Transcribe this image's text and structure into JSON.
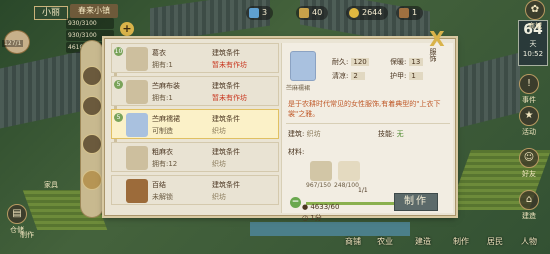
{
  "hud": {
    "player_name": "小丽",
    "region": "春来小镇",
    "stats": [
      "930/3100",
      "930/3100",
      "4610/3100"
    ],
    "population": "127/1"
  },
  "resources": [
    {
      "icon": "gem-icon",
      "value": "3",
      "color": "#5fa0d0"
    },
    {
      "icon": "food-icon",
      "value": "40",
      "color": "#c9a24a"
    },
    {
      "icon": "coin-icon",
      "value": "2644",
      "color": "#e0b840"
    },
    {
      "icon": "wood-icon",
      "value": "1",
      "color": "#a07040"
    }
  ],
  "season": {
    "number": "64",
    "unit": "天",
    "time": "10:52"
  },
  "right_buttons": [
    "商城",
    "事件",
    "活动",
    "好友",
    "建造"
  ],
  "left_buttons": [
    "家具",
    "仓储",
    "制作"
  ],
  "bottom_menu": [
    "商铺",
    "农业",
    "建造",
    "制作",
    "居民",
    "人物"
  ],
  "close_label": "X",
  "panel_side_label": "服饰",
  "items": [
    {
      "no": "10",
      "name": "葛衣",
      "owned": "拥有:1",
      "cond": "建筑条件",
      "cond_value": "暂未有作坊",
      "cond_color": "red"
    },
    {
      "no": "5",
      "name": "苎麻布装",
      "owned": "拥有:1",
      "cond": "建筑条件",
      "cond_value": "暂未有作坊",
      "cond_color": "red"
    },
    {
      "no": "5",
      "name": "苎麻襦裙",
      "owned": "可制造",
      "cond": "建筑条件",
      "cond_value": "织坊",
      "cond_color": "gray"
    },
    {
      "no": "",
      "name": "粗麻衣",
      "owned": "拥有:12",
      "cond": "建筑条件",
      "cond_value": "织坊",
      "cond_color": "gray"
    },
    {
      "no": "",
      "name": "百结",
      "owned": "未解锁",
      "cond": "建筑条件",
      "cond_value": "织坊",
      "cond_color": "gray"
    }
  ],
  "detail": {
    "name": "苎麻襦裙",
    "stats": [
      {
        "label": "耐久:",
        "value": "120"
      },
      {
        "label": "保暖:",
        "value": "13"
      },
      {
        "label": "清凉:",
        "value": "2"
      },
      {
        "label": "护甲:",
        "value": "1"
      }
    ],
    "description": "是于农耕时代常见的女性服饰,有着典型的\"上衣下裳\"之雅。",
    "building_label": "建筑:",
    "building_value": "织坊",
    "skill_label": "技能:",
    "skill_value": "无",
    "materials_label": "材料:",
    "materials": [
      {
        "name": "苎麻布",
        "qty": "967/150"
      },
      {
        "name": "丝线",
        "qty": "248/100"
      }
    ],
    "count": "1/1",
    "money": "4633/60",
    "time": "1分",
    "craft_button": "制作",
    "progress": 1
  }
}
